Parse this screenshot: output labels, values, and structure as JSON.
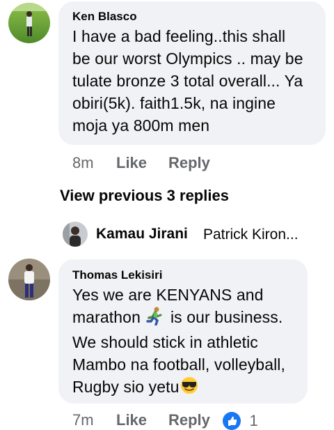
{
  "comments": [
    {
      "author": "Ken Blasco",
      "lines": [
        "I have a bad feeling..this shall",
        "be our worst Olympics .. may be",
        "tulate bronze 3 total overall... Ya",
        "obiri(5k). faith1.5k, na ingine",
        "moja ya 800m men"
      ],
      "time": "8m",
      "like_label": "Like",
      "reply_label": "Reply"
    },
    {
      "author": "Thomas Lekisiri",
      "lines": [
        "Yes we are KENYANS and",
        "marathon",
        "is our business.",
        "We should stick in athletic",
        "Mambo na football, volleyball,",
        "Rugby sio yetu"
      ],
      "time": "7m",
      "like_label": "Like",
      "reply_label": "Reply",
      "reaction_count": "1",
      "reaction_icon": "like-reaction-icon"
    }
  ],
  "view_previous": "View previous 3 replies",
  "reply_preview": {
    "name": "Kamau Jirani",
    "text": "Patrick Kiron..."
  },
  "colors": {
    "bubble": "#f0f2f5",
    "meta": "#65676b",
    "like_blue": "#1877f2"
  }
}
